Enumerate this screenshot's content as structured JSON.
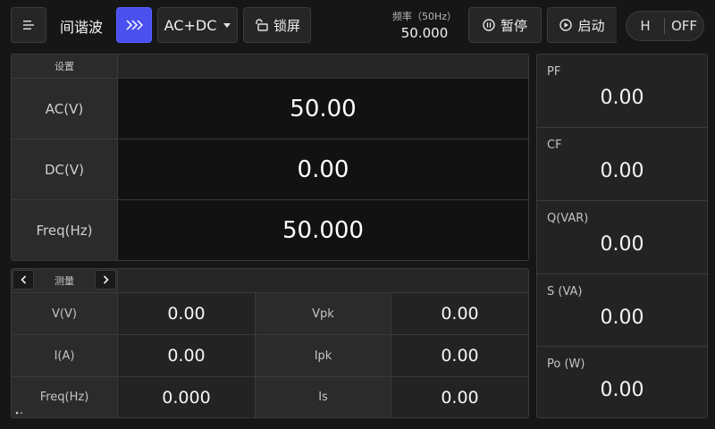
{
  "header": {
    "title": "间谐波",
    "mode_label": "AC+DC",
    "lock_label": "锁屏",
    "frequency": {
      "label": "频率（50Hz）",
      "value": "50.000"
    },
    "pause_label": "暂停",
    "start_label": "启动",
    "toggle": {
      "left": "H",
      "right": "OFF"
    }
  },
  "settings": {
    "header": "设置",
    "rows": [
      {
        "label": "AC(V)",
        "value": "50.00"
      },
      {
        "label": "DC(V)",
        "value": "0.00"
      },
      {
        "label": "Freq(Hz)",
        "value": "50.000"
      }
    ]
  },
  "measure": {
    "header": "测量",
    "rows": [
      {
        "label1": "V(V)",
        "value1": "0.00",
        "label2": "Vpk",
        "value2": "0.00"
      },
      {
        "label1": "I(A)",
        "value1": "0.00",
        "label2": "Ipk",
        "value2": "0.00"
      },
      {
        "label1": "Freq(Hz)",
        "value1": "0.000",
        "label2": "Is",
        "value2": "0.00"
      }
    ]
  },
  "side": {
    "items": [
      {
        "label": "PF",
        "value": "0.00"
      },
      {
        "label": "CF",
        "value": "0.00"
      },
      {
        "label": "Q(VAR)",
        "value": "0.00"
      },
      {
        "label": "S (VA)",
        "value": "0.00"
      },
      {
        "label": "Po (W)",
        "value": "0.00"
      }
    ]
  },
  "colors": {
    "accent": "#4a50ee",
    "background": "#161616",
    "panel": "#232323"
  },
  "icons": [
    "menu-icon",
    "fast-forward-icon",
    "caret-down-icon",
    "unlock-icon",
    "pause-icon",
    "play-icon",
    "chevron-left-icon",
    "chevron-right-icon"
  ]
}
